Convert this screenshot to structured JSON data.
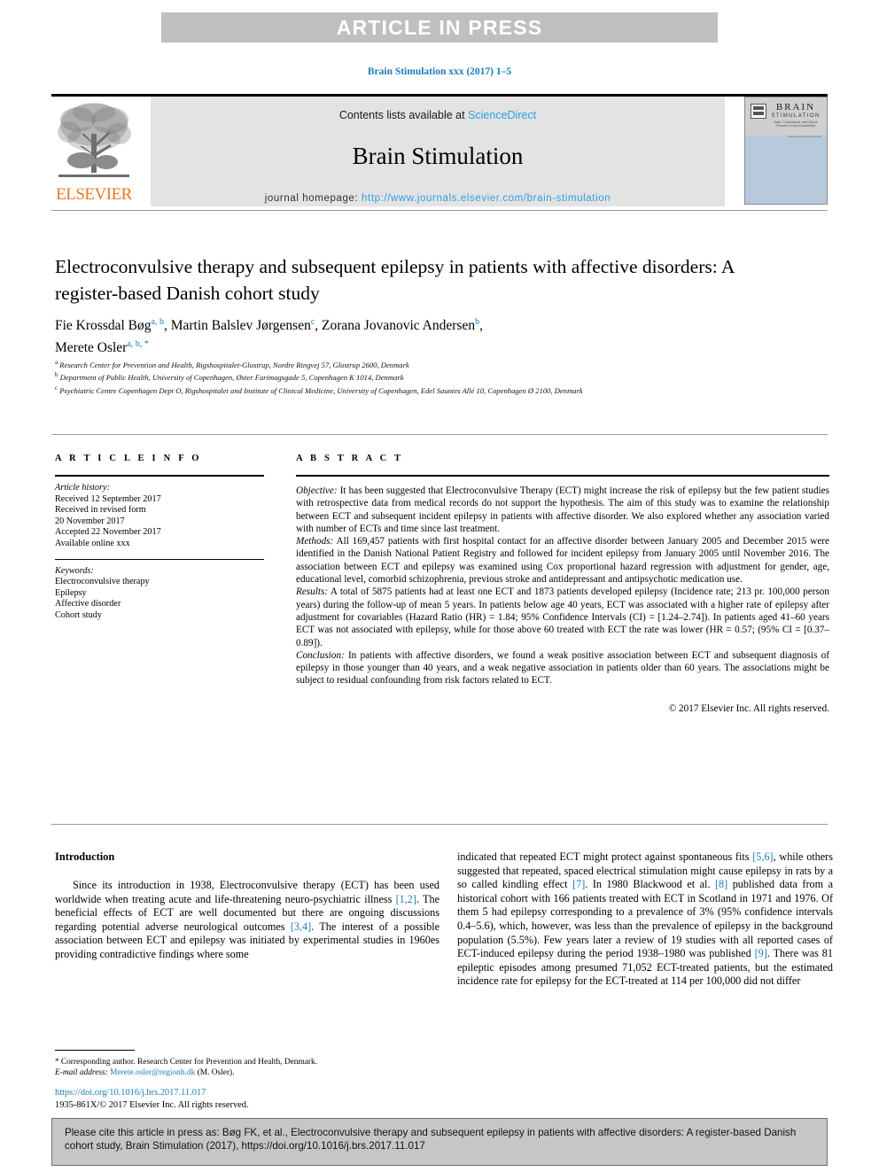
{
  "banner": {
    "text": "ARTICLE IN PRESS"
  },
  "running_head": {
    "text": "Brain Stimulation xxx (2017) 1–5"
  },
  "masthead": {
    "contents_prefix": "Contents lists available at ",
    "contents_link": "ScienceDirect",
    "journal_name": "Brain Stimulation",
    "homepage_label": "journal homepage:",
    "homepage_url": "http://www.journals.elsevier.com/brain-stimulation",
    "publisher_wordmark": "ELSEVIER",
    "cover": {
      "brain": "BRAIN",
      "stimulation": "STIMULATION",
      "subtitle": "Basic, Translational, and Clinical Research in Neuromodulation",
      "url": "www.elsevier.com/locate/brs"
    }
  },
  "article": {
    "title": "Electroconvulsive therapy and subsequent epilepsy in patients with affective disorders: A register-based Danish cohort study",
    "authors_line1_a": "Fie Krossdal Bøg",
    "authors_line1_a_marks": "a, b",
    "authors_line1_b": ", Martin Balslev Jørgensen",
    "authors_line1_b_marks": "c",
    "authors_line1_c": ", Zorana Jovanovic Andersen",
    "authors_line1_c_marks": "b",
    "authors_line1_comma": ",",
    "authors_line2": "Merete Osler",
    "authors_line2_marks": "a, b, *",
    "affiliations": [
      {
        "mark": "a",
        "text": "Research Center for Prevention and Health, Rigshospitalet-Glostrup, Nordre Ringvej 57, Glostrup 2600, Denmark"
      },
      {
        "mark": "b",
        "text": "Department of Public Health, University of Copenhagen, Øster Farimagsgade 5, Copenhagen K 1014, Denmark"
      },
      {
        "mark": "c",
        "text": "Psychiatric Centre Copenhagen Dept O, Rigshospitalet and Institute of Clinical Medicine, University of Copenhagen, Edel Sauntes Allé 10, Copenhagen Ø 2100, Denmark"
      }
    ]
  },
  "article_info": {
    "heading": "A R T I C L E   I N F O",
    "history_label": "Article history:",
    "history": [
      "Received 12 September 2017",
      "Received in revised form",
      "20 November 2017",
      "Accepted 22 November 2017",
      "Available online xxx"
    ],
    "keywords_label": "Keywords:",
    "keywords": [
      "Electroconvulsive therapy",
      "Epilepsy",
      "Affective disorder",
      "Cohort study"
    ]
  },
  "abstract": {
    "heading": "A B S T R A C T",
    "objective_label": "Objective:",
    "objective_text": " It has been suggested that Electroconvulsive Therapy (ECT) might increase the risk of epilepsy but the few patient studies with retrospective data from medical records do not support the hypothesis. The aim of this study was to examine the relationship between ECT and subsequent incident epilepsy in patients with affective disorder. We also explored whether any association varied with number of ECTs and time since last treatment.",
    "methods_label": "Methods:",
    "methods_text": " All 169,457 patients with first hospital contact for an affective disorder between January 2005 and December 2015 were identified in the Danish National Patient Registry and followed for incident epilepsy from January 2005 until November 2016. The association between ECT and epilepsy was examined using Cox proportional hazard regression with adjustment for gender, age, educational level, comorbid schizophrenia, previous stroke and antidepressant and antipsychotic medication use.",
    "results_label": "Results:",
    "results_text": " A total of 5875 patients had at least one ECT and 1873 patients developed epilepsy (Incidence rate; 213 pr. 100,000 person years) during the follow-up of mean 5 years. In patients below age 40 years, ECT was associated with a higher rate of epilepsy after adjustment for covariables (Hazard Ratio (HR) = 1.84; 95% Confidence Intervals (CI) = [1.24–2.74]). In patients aged 41–60 years ECT was not associated with epilepsy, while for those above 60 treated with ECT the rate was lower (HR = 0.57; (95% CI = [0.37–0.89]).",
    "conclusion_label": "Conclusion:",
    "conclusion_text": " In patients with affective disorders, we found a weak positive association between ECT and subsequent diagnosis of epilepsy in those younger than 40 years, and a weak negative association in patients older than 60 years. The associations might be subject to residual confounding from risk factors related to ECT.",
    "copyright": "© 2017 Elsevier Inc. All rights reserved."
  },
  "introduction": {
    "heading": "Introduction",
    "left_p1_part1": "Since its introduction in 1938, Electroconvulsive therapy (ECT) has been used worldwide when treating acute and life-threatening neuro-psychiatric illness ",
    "left_ref1": "[1,2]",
    "left_p1_part2": ". The beneficial effects of ECT are well documented but there are ongoing discussions regarding potential adverse neurological outcomes ",
    "left_ref2": "[3,4]",
    "left_p1_part3": ". The interest of a possible association between ECT and epilepsy was initiated by experimental studies in 1960es providing contradictive findings where some",
    "right_part1": "indicated that repeated ECT might protect against spontaneous fits ",
    "right_ref1": "[5,6]",
    "right_part2": ", while others suggested that repeated, spaced electrical stimulation might cause epilepsy in rats by a so called kindling effect ",
    "right_ref2": "[7]",
    "right_part3": ". In 1980 Blackwood et al. ",
    "right_ref3": "[8]",
    "right_part4": " published data from a historical cohort with 166 patients treated with ECT in Scotland in 1971 and 1976. Of them 5 had epilepsy corresponding to a prevalence of 3% (95% confidence intervals 0.4–5.6), which, however, was less than the prevalence of epilepsy in the background population (5.5%). Few years later a review of 19 studies with all reported cases of ECT-induced epilepsy during the period 1938–1980 was published ",
    "right_ref4": "[9]",
    "right_part5": ". There was 81 epileptic episodes among presumed 71,052 ECT-treated patients, but the estimated incidence rate for epilepsy for the ECT-treated at 114 per 100,000 did not differ"
  },
  "footnote": {
    "marker": "*",
    "corresponding": " Corresponding author. Research Center for Prevention and Health, Denmark.",
    "email_label": "E-mail address:",
    "email": "Merete.osler@regionh.dk",
    "email_suffix": " (M. Osler)."
  },
  "footer": {
    "doi": "https://doi.org/10.1016/j.brs.2017.11.017",
    "issn_copyright": "1935-861X/© 2017 Elsevier Inc. All rights reserved."
  },
  "cite_box": {
    "text": "Please cite this article in press as: Bøg FK, et al., Electroconvulsive therapy and subsequent epilepsy in patients with affective disorders: A register-based Danish cohort study, Brain Stimulation (2017), https://doi.org/10.1016/j.brs.2017.11.017"
  },
  "colors": {
    "link_blue": "#1a7bb9",
    "sciencedirect_blue": "#2da0e0",
    "elsevier_orange": "#e87722",
    "banner_gray": "#bfbfbf",
    "masthead_gray": "#e3e3e3",
    "cover_blue": "#b6cadb",
    "cite_box_gray": "#c6c6c6"
  }
}
